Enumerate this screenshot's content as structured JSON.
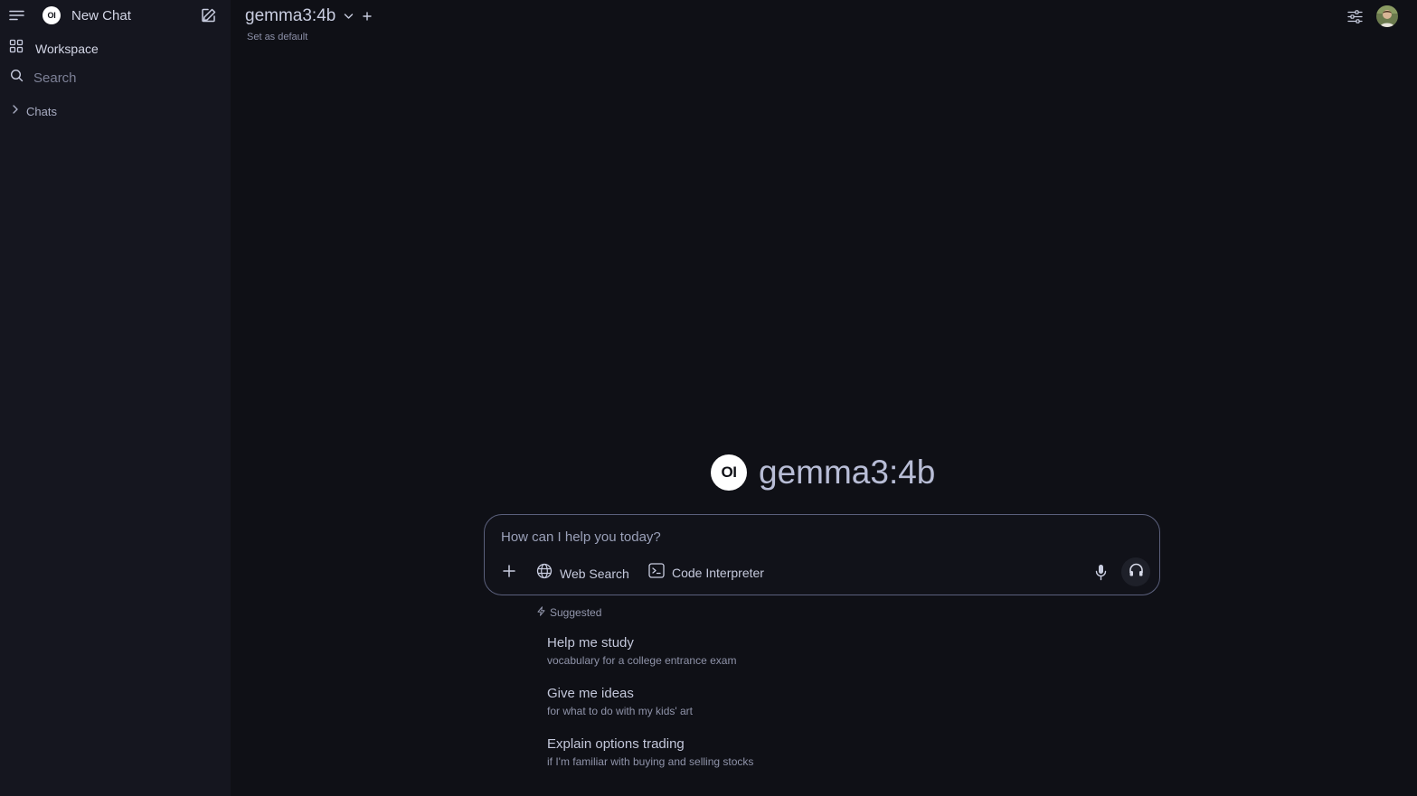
{
  "sidebar": {
    "new_chat_label": "New Chat",
    "logo_text": "OI",
    "workspace_label": "Workspace",
    "search_label": "Search",
    "chats_label": "Chats"
  },
  "header": {
    "model_name": "gemma3:4b",
    "set_default_label": "Set as default"
  },
  "hero": {
    "logo_text": "OI",
    "model_name": "gemma3:4b"
  },
  "composer": {
    "placeholder": "How can I help you today?",
    "web_search_label": "Web Search",
    "code_interpreter_label": "Code Interpreter"
  },
  "suggestions": {
    "heading": "Suggested",
    "items": [
      {
        "title": "Help me study",
        "subtitle": "vocabulary for a college entrance exam"
      },
      {
        "title": "Give me ideas",
        "subtitle": "for what to do with my kids' art"
      },
      {
        "title": "Explain options trading",
        "subtitle": "if I'm familiar with buying and selling stocks"
      }
    ]
  },
  "icons": {
    "menu": "menu-icon",
    "edit": "new-chat-edit-icon",
    "workspace": "workspace-grid-icon",
    "search": "search-icon",
    "chevron_right": "chevron-right-icon",
    "chevron_down": "chevron-down-icon",
    "plus": "plus-icon",
    "settings": "controls-sliders-icon",
    "globe": "globe-icon",
    "terminal": "terminal-icon",
    "mic": "microphone-icon",
    "headphones": "headphones-icon",
    "sparkle": "sparkle-icon"
  },
  "colors": {
    "background": "#0f1016",
    "sidebar": "#15161f",
    "composer_border": "#5b607c"
  }
}
